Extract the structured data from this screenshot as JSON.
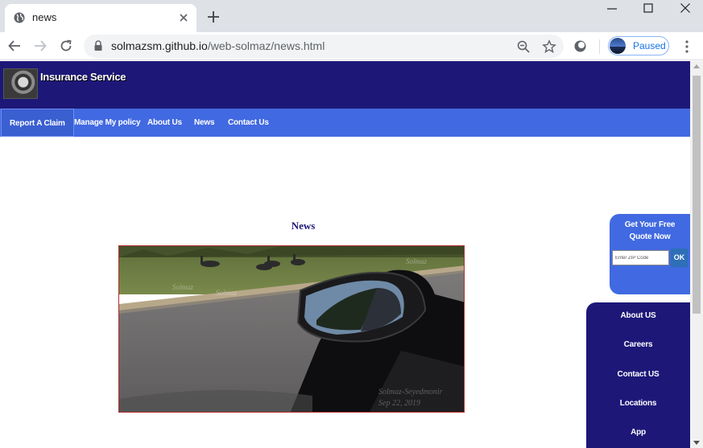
{
  "browser": {
    "tab_title": "news",
    "url_host": "solmazsm.github.io",
    "url_path": "/web-solmaz/news.html",
    "profile_status": "Paused"
  },
  "site": {
    "title": "Insurance Service",
    "nav": [
      {
        "label": "Report A Claim"
      },
      {
        "label": "Manage My policy"
      },
      {
        "label": "About Us"
      },
      {
        "label": "News"
      },
      {
        "label": "Contact Us"
      }
    ],
    "news_heading": "News",
    "photo_watermarks": {
      "name": "Solmaz-Seyedmonir",
      "date": "Sep 22, 2019",
      "small": "Solmaz"
    },
    "quote": {
      "title": "Get Your Free Quote Now",
      "zip_placeholder": "Enter ZIP Code",
      "ok_label": "OK"
    },
    "side_menu": [
      {
        "label": "About US"
      },
      {
        "label": "Careers"
      },
      {
        "label": "Contact US"
      },
      {
        "label": "Locations"
      },
      {
        "label": "App"
      }
    ]
  },
  "colors": {
    "header": "#1d1878",
    "nav": "#4169e1",
    "heading": "#1d1878",
    "photo_border": "#b03030"
  }
}
